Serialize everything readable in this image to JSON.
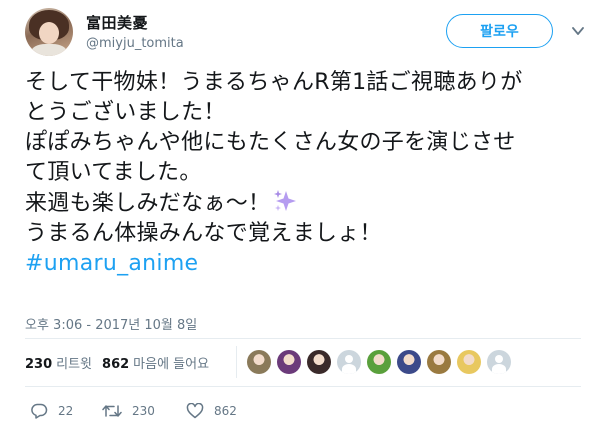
{
  "user": {
    "display_name": "富田美憂",
    "handle": "@miyju_tomita",
    "avatar_icon": "user-avatar-photo"
  },
  "follow_button": {
    "label": "팔로우"
  },
  "menu": {
    "icon": "caret-down-icon"
  },
  "tweet": {
    "lines": [
      "そして干物妹！うまるちゃんR第1話ご視聴ありが",
      "とうございました！",
      "ぽぽみちゃんや他にもたくさん女の子を演じさせ",
      "て頂いてました。",
      "来週も楽しみだなぁ〜！",
      "うまるん体操みんなで覚えましょ！"
    ],
    "sparkle_icon": "sparkles-emoji-icon",
    "hashtag": "#umaru_anime"
  },
  "timestamp": "오후 3:06 - 2017년 10월 8일",
  "stats": {
    "retweets_count": "230",
    "retweets_label": "리트윗",
    "likes_count": "862",
    "likes_label": "마음에 들어요"
  },
  "likers": [
    {
      "icon": "user-avatar-photo",
      "color": "#8a7a5a"
    },
    {
      "icon": "user-avatar-photo",
      "color": "#6b3a7a"
    },
    {
      "icon": "user-avatar-photo",
      "color": "#3a2a2a"
    },
    {
      "icon": "default-avatar-icon",
      "color": "#ccd6dd"
    },
    {
      "icon": "user-avatar-photo",
      "color": "#5aa03c"
    },
    {
      "icon": "user-avatar-photo",
      "color": "#3c4a8a"
    },
    {
      "icon": "user-avatar-photo",
      "color": "#9a7a40"
    },
    {
      "icon": "user-avatar-photo",
      "color": "#e8c860"
    },
    {
      "icon": "default-avatar-icon",
      "color": "#ccd6dd"
    }
  ],
  "actions": {
    "reply_count": "22",
    "retweet_count": "230",
    "like_count": "862"
  },
  "colors": {
    "accent": "#1da1f2",
    "text": "#14171a",
    "secondary": "#657786",
    "divider": "#e6ecf0"
  }
}
